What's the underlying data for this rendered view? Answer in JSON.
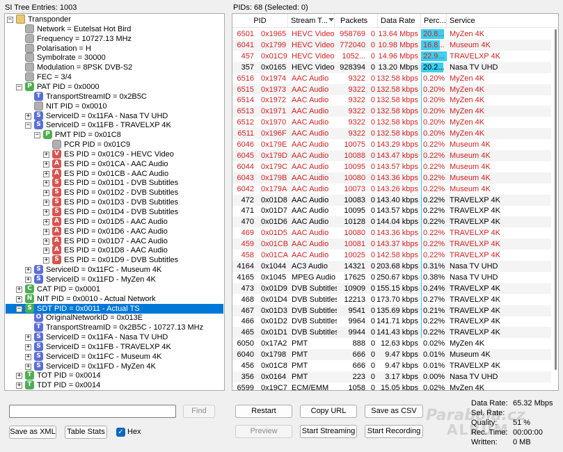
{
  "left_header": "SI Tree Entries: 1003",
  "right_header": "PIDs: 68  (Selected: 0)",
  "tree": [
    {
      "depth": 0,
      "toggle": "-",
      "icon": "folder",
      "letter": "",
      "color": "",
      "text": "Transponder"
    },
    {
      "depth": 1,
      "toggle": "",
      "icon": "grey",
      "letter": "",
      "color": "",
      "text": "Network = Eutelsat Hot Bird"
    },
    {
      "depth": 1,
      "toggle": "",
      "icon": "grey",
      "letter": "",
      "color": "",
      "text": "Frequency = 10727.13 MHz"
    },
    {
      "depth": 1,
      "toggle": "",
      "icon": "grey",
      "letter": "",
      "color": "",
      "text": "Polarisation = H"
    },
    {
      "depth": 1,
      "toggle": "",
      "icon": "grey",
      "letter": "",
      "color": "",
      "text": "Symbolrate = 30000"
    },
    {
      "depth": 1,
      "toggle": "",
      "icon": "grey",
      "letter": "",
      "color": "",
      "text": "Modulation = 8PSK DVB-S2"
    },
    {
      "depth": 1,
      "toggle": "",
      "icon": "grey",
      "letter": "",
      "color": "",
      "text": "FEC = 3/4"
    },
    {
      "depth": 1,
      "toggle": "-",
      "icon": "letter",
      "letter": "P",
      "color": "#4caf50",
      "text": "PAT PID = 0x0000"
    },
    {
      "depth": 2,
      "toggle": "",
      "icon": "letter",
      "letter": "T",
      "color": "#5b6fd6",
      "text": "TransportStreamID = 0x2B5C"
    },
    {
      "depth": 2,
      "toggle": "",
      "icon": "grey",
      "letter": "",
      "color": "",
      "text": "NIT PID = 0x0010"
    },
    {
      "depth": 2,
      "toggle": "+",
      "icon": "letter",
      "letter": "S",
      "color": "#5b6fd6",
      "text": "ServiceID = 0x11FA - Nasa TV UHD"
    },
    {
      "depth": 2,
      "toggle": "-",
      "icon": "letter",
      "letter": "S",
      "color": "#5b6fd6",
      "text": "ServiceID = 0x11FB - TRAVELXP 4K"
    },
    {
      "depth": 3,
      "toggle": "-",
      "icon": "letter",
      "letter": "P",
      "color": "#4caf50",
      "text": "PMT PID = 0x01C8"
    },
    {
      "depth": 4,
      "toggle": "",
      "icon": "grey",
      "letter": "",
      "color": "",
      "text": "PCR PID = 0x01C9"
    },
    {
      "depth": 4,
      "toggle": "+",
      "icon": "letter",
      "letter": "V",
      "color": "#d9534f",
      "text": "ES PID = 0x01C9 - HEVC Video"
    },
    {
      "depth": 4,
      "toggle": "+",
      "icon": "letter",
      "letter": "A",
      "color": "#d9534f",
      "text": "ES PID = 0x01CA - AAC Audio"
    },
    {
      "depth": 4,
      "toggle": "+",
      "icon": "letter",
      "letter": "A",
      "color": "#d9534f",
      "text": "ES PID = 0x01CB - AAC Audio"
    },
    {
      "depth": 4,
      "toggle": "+",
      "icon": "letter",
      "letter": "S",
      "color": "#d9534f",
      "text": "ES PID = 0x01D1 - DVB Subtitles"
    },
    {
      "depth": 4,
      "toggle": "+",
      "icon": "letter",
      "letter": "S",
      "color": "#d9534f",
      "text": "ES PID = 0x01D2 - DVB Subtitles"
    },
    {
      "depth": 4,
      "toggle": "+",
      "icon": "letter",
      "letter": "S",
      "color": "#d9534f",
      "text": "ES PID = 0x01D3 - DVB Subtitles"
    },
    {
      "depth": 4,
      "toggle": "+",
      "icon": "letter",
      "letter": "S",
      "color": "#d9534f",
      "text": "ES PID = 0x01D4 - DVB Subtitles"
    },
    {
      "depth": 4,
      "toggle": "+",
      "icon": "letter",
      "letter": "A",
      "color": "#d9534f",
      "text": "ES PID = 0x01D5 - AAC Audio"
    },
    {
      "depth": 4,
      "toggle": "+",
      "icon": "letter",
      "letter": "A",
      "color": "#d9534f",
      "text": "ES PID = 0x01D6 - AAC Audio"
    },
    {
      "depth": 4,
      "toggle": "+",
      "icon": "letter",
      "letter": "A",
      "color": "#d9534f",
      "text": "ES PID = 0x01D7 - AAC Audio"
    },
    {
      "depth": 4,
      "toggle": "+",
      "icon": "letter",
      "letter": "A",
      "color": "#d9534f",
      "text": "ES PID = 0x01D8 - AAC Audio"
    },
    {
      "depth": 4,
      "toggle": "+",
      "icon": "letter",
      "letter": "S",
      "color": "#d9534f",
      "text": "ES PID = 0x01D9 - DVB Subtitles"
    },
    {
      "depth": 2,
      "toggle": "+",
      "icon": "letter",
      "letter": "S",
      "color": "#5b6fd6",
      "text": "ServiceID = 0x11FC - Museum 4K"
    },
    {
      "depth": 2,
      "toggle": "+",
      "icon": "letter",
      "letter": "S",
      "color": "#5b6fd6",
      "text": "ServiceID = 0x11FD - MyZen 4K"
    },
    {
      "depth": 1,
      "toggle": "+",
      "icon": "letter",
      "letter": "C",
      "color": "#4caf50",
      "text": "CAT PID = 0x0001"
    },
    {
      "depth": 1,
      "toggle": "+",
      "icon": "letter",
      "letter": "N",
      "color": "#4caf50",
      "text": "NIT PID = 0x0010 - Actual Network"
    },
    {
      "depth": 1,
      "toggle": "-",
      "icon": "letter",
      "letter": "S",
      "color": "#4caf50",
      "text": "SDT PID = 0x0011 - Actual TS",
      "selected": true
    },
    {
      "depth": 2,
      "toggle": "",
      "icon": "letter",
      "letter": "O",
      "color": "#5b6fd6",
      "text": "OriginalNetworkID = 0x013E"
    },
    {
      "depth": 2,
      "toggle": "",
      "icon": "letter",
      "letter": "T",
      "color": "#5b6fd6",
      "text": "TransportStreamID = 0x2B5C - 10727.13 MHz"
    },
    {
      "depth": 2,
      "toggle": "+",
      "icon": "letter",
      "letter": "S",
      "color": "#5b6fd6",
      "text": "ServiceID = 0x11FA - Nasa TV UHD"
    },
    {
      "depth": 2,
      "toggle": "+",
      "icon": "letter",
      "letter": "S",
      "color": "#5b6fd6",
      "text": "ServiceID = 0x11FB - TRAVELXP 4K"
    },
    {
      "depth": 2,
      "toggle": "+",
      "icon": "letter",
      "letter": "S",
      "color": "#5b6fd6",
      "text": "ServiceID = 0x11FC - Museum 4K"
    },
    {
      "depth": 2,
      "toggle": "+",
      "icon": "letter",
      "letter": "S",
      "color": "#5b6fd6",
      "text": "ServiceID = 0x11FD - MyZen 4K"
    },
    {
      "depth": 1,
      "toggle": "+",
      "icon": "letter",
      "letter": "T",
      "color": "#4caf50",
      "text": "TOT PID = 0x0014"
    },
    {
      "depth": 1,
      "toggle": "+",
      "icon": "letter",
      "letter": "T",
      "color": "#4caf50",
      "text": "TDT PID = 0x0014"
    }
  ],
  "columns": [
    "PID",
    "Stream T...",
    "Packets",
    "Data Rate",
    "Perc...",
    "Service"
  ],
  "rows": [
    {
      "pid_dec": "6501",
      "pid_hex": "0x1965",
      "type": "HEVC Video",
      "packets": "958769",
      "cc": "0",
      "rate": "13.64 Mbps",
      "perc": "20.8...",
      "pct": 20.8,
      "service": "MyZen 4K",
      "red": true
    },
    {
      "pid_dec": "6041",
      "pid_hex": "0x1799",
      "type": "HEVC Video",
      "packets": "772040",
      "cc": "0",
      "rate": "10.98 Mbps",
      "perc": "16.8...",
      "pct": 16.8,
      "service": "Museum 4K",
      "red": true
    },
    {
      "pid_dec": "457",
      "pid_hex": "0x01C9",
      "type": "HEVC Video",
      "packets": "1052...",
      "cc": "0",
      "rate": "14.96 Mbps",
      "perc": "22.9...",
      "pct": 22.9,
      "service": "TRAVELXP 4K",
      "red": true
    },
    {
      "pid_dec": "357",
      "pid_hex": "0x0165",
      "type": "HEVC Video",
      "packets": "928394",
      "cc": "0",
      "rate": "13.20 Mbps",
      "perc": "20.2...",
      "pct": 20.2,
      "service": "Nasa TV UHD",
      "red": false
    },
    {
      "pid_dec": "6516",
      "pid_hex": "0x1974",
      "type": "AAC Audio",
      "packets": "9322",
      "cc": "0",
      "rate": "132.58 kbps",
      "perc": "0.20%",
      "pct": 0.2,
      "service": "MyZen 4K",
      "red": true
    },
    {
      "pid_dec": "6515",
      "pid_hex": "0x1973",
      "type": "AAC Audio",
      "packets": "9322",
      "cc": "0",
      "rate": "132.58 kbps",
      "perc": "0.20%",
      "pct": 0.2,
      "service": "MyZen 4K",
      "red": true
    },
    {
      "pid_dec": "6514",
      "pid_hex": "0x1972",
      "type": "AAC Audio",
      "packets": "9322",
      "cc": "0",
      "rate": "132.58 kbps",
      "perc": "0.20%",
      "pct": 0.2,
      "service": "MyZen 4K",
      "red": true
    },
    {
      "pid_dec": "6513",
      "pid_hex": "0x1971",
      "type": "AAC Audio",
      "packets": "9322",
      "cc": "0",
      "rate": "132.58 kbps",
      "perc": "0.20%",
      "pct": 0.2,
      "service": "MyZen 4K",
      "red": true
    },
    {
      "pid_dec": "6512",
      "pid_hex": "0x1970",
      "type": "AAC Audio",
      "packets": "9322",
      "cc": "0",
      "rate": "132.58 kbps",
      "perc": "0.20%",
      "pct": 0.2,
      "service": "MyZen 4K",
      "red": true
    },
    {
      "pid_dec": "6511",
      "pid_hex": "0x196F",
      "type": "AAC Audio",
      "packets": "9322",
      "cc": "0",
      "rate": "132.58 kbps",
      "perc": "0.20%",
      "pct": 0.2,
      "service": "MyZen 4K",
      "red": true
    },
    {
      "pid_dec": "6046",
      "pid_hex": "0x179E",
      "type": "AAC Audio",
      "packets": "10075",
      "cc": "0",
      "rate": "143.29 kbps",
      "perc": "0.22%",
      "pct": 0.22,
      "service": "Museum 4K",
      "red": true
    },
    {
      "pid_dec": "6045",
      "pid_hex": "0x179D",
      "type": "AAC Audio",
      "packets": "10088",
      "cc": "0",
      "rate": "143.47 kbps",
      "perc": "0.22%",
      "pct": 0.22,
      "service": "Museum 4K",
      "red": true
    },
    {
      "pid_dec": "6044",
      "pid_hex": "0x179C",
      "type": "AAC Audio",
      "packets": "10095",
      "cc": "0",
      "rate": "143.57 kbps",
      "perc": "0.22%",
      "pct": 0.22,
      "service": "Museum 4K",
      "red": true
    },
    {
      "pid_dec": "6043",
      "pid_hex": "0x179B",
      "type": "AAC Audio",
      "packets": "10080",
      "cc": "0",
      "rate": "143.36 kbps",
      "perc": "0.22%",
      "pct": 0.22,
      "service": "Museum 4K",
      "red": true
    },
    {
      "pid_dec": "6042",
      "pid_hex": "0x179A",
      "type": "AAC Audio",
      "packets": "10073",
      "cc": "0",
      "rate": "143.26 kbps",
      "perc": "0.22%",
      "pct": 0.22,
      "service": "Museum 4K",
      "red": true
    },
    {
      "pid_dec": "472",
      "pid_hex": "0x01D8",
      "type": "AAC Audio",
      "packets": "10083",
      "cc": "0",
      "rate": "143.40 kbps",
      "perc": "0.22%",
      "pct": 0.22,
      "service": "TRAVELXP 4K",
      "red": false
    },
    {
      "pid_dec": "471",
      "pid_hex": "0x01D7",
      "type": "AAC Audio",
      "packets": "10095",
      "cc": "0",
      "rate": "143.57 kbps",
      "perc": "0.22%",
      "pct": 0.22,
      "service": "TRAVELXP 4K",
      "red": false
    },
    {
      "pid_dec": "470",
      "pid_hex": "0x01D6",
      "type": "AAC Audio",
      "packets": "10128",
      "cc": "0",
      "rate": "144.04 kbps",
      "perc": "0.22%",
      "pct": 0.22,
      "service": "TRAVELXP 4K",
      "red": false
    },
    {
      "pid_dec": "469",
      "pid_hex": "0x01D5",
      "type": "AAC Audio",
      "packets": "10080",
      "cc": "0",
      "rate": "143.36 kbps",
      "perc": "0.22%",
      "pct": 0.22,
      "service": "TRAVELXP 4K",
      "red": true
    },
    {
      "pid_dec": "459",
      "pid_hex": "0x01CB",
      "type": "AAC Audio",
      "packets": "10081",
      "cc": "0",
      "rate": "143.37 kbps",
      "perc": "0.22%",
      "pct": 0.22,
      "service": "TRAVELXP 4K",
      "red": true
    },
    {
      "pid_dec": "458",
      "pid_hex": "0x01CA",
      "type": "AAC Audio",
      "packets": "10025",
      "cc": "0",
      "rate": "142.58 kbps",
      "perc": "0.22%",
      "pct": 0.22,
      "service": "TRAVELXP 4K",
      "red": true
    },
    {
      "pid_dec": "4164",
      "pid_hex": "0x1044",
      "type": "AC3 Audio",
      "packets": "14321",
      "cc": "0",
      "rate": "203.68 kbps",
      "perc": "0.31%",
      "pct": 0.31,
      "service": "Nasa TV UHD",
      "red": false
    },
    {
      "pid_dec": "4165",
      "pid_hex": "0x1045",
      "type": "MPEG Audio",
      "packets": "17625",
      "cc": "0",
      "rate": "250.67 kbps",
      "perc": "0.38%",
      "pct": 0.38,
      "service": "Nasa TV UHD",
      "red": false
    },
    {
      "pid_dec": "473",
      "pid_hex": "0x01D9",
      "type": "DVB Subtitles",
      "packets": "10909",
      "cc": "0",
      "rate": "155.15 kbps",
      "perc": "0.24%",
      "pct": 0.24,
      "service": "TRAVELXP 4K",
      "red": false
    },
    {
      "pid_dec": "468",
      "pid_hex": "0x01D4",
      "type": "DVB Subtitles",
      "packets": "12213",
      "cc": "0",
      "rate": "173.70 kbps",
      "perc": "0.27%",
      "pct": 0.27,
      "service": "TRAVELXP 4K",
      "red": false
    },
    {
      "pid_dec": "467",
      "pid_hex": "0x01D3",
      "type": "DVB Subtitles",
      "packets": "9541",
      "cc": "0",
      "rate": "135.69 kbps",
      "perc": "0.21%",
      "pct": 0.21,
      "service": "TRAVELXP 4K",
      "red": false
    },
    {
      "pid_dec": "466",
      "pid_hex": "0x01D2",
      "type": "DVB Subtitles",
      "packets": "9964",
      "cc": "0",
      "rate": "141.71 kbps",
      "perc": "0.22%",
      "pct": 0.22,
      "service": "TRAVELXP 4K",
      "red": false
    },
    {
      "pid_dec": "465",
      "pid_hex": "0x01D1",
      "type": "DVB Subtitles",
      "packets": "9944",
      "cc": "0",
      "rate": "141.43 kbps",
      "perc": "0.22%",
      "pct": 0.22,
      "service": "TRAVELXP 4K",
      "red": false
    },
    {
      "pid_dec": "6050",
      "pid_hex": "0x17A2",
      "type": "PMT",
      "packets": "888",
      "cc": "0",
      "rate": "12.63 kbps",
      "perc": "0.02%",
      "pct": 0.02,
      "service": "MyZen 4K",
      "red": false
    },
    {
      "pid_dec": "6040",
      "pid_hex": "0x1798",
      "type": "PMT",
      "packets": "666",
      "cc": "0",
      "rate": "9.47 kbps",
      "perc": "0.01%",
      "pct": 0.01,
      "service": "Museum 4K",
      "red": false
    },
    {
      "pid_dec": "456",
      "pid_hex": "0x01C8",
      "type": "PMT",
      "packets": "666",
      "cc": "0",
      "rate": "9.47 kbps",
      "perc": "0.01%",
      "pct": 0.01,
      "service": "TRAVELXP 4K",
      "red": false
    },
    {
      "pid_dec": "356",
      "pid_hex": "0x0164",
      "type": "PMT",
      "packets": "223",
      "cc": "0",
      "rate": "3.17 kbps",
      "perc": "0.00%",
      "pct": 0.0,
      "service": "Nasa TV UHD",
      "red": false
    },
    {
      "pid_dec": "6599",
      "pid_hex": "0x19C7",
      "type": "ECM/EMM",
      "packets": "1058",
      "cc": "0",
      "rate": "15.05 kbps",
      "perc": "0.02%",
      "pct": 0.02,
      "service": "MyZen 4K",
      "red": false
    }
  ],
  "find_placeholder": "",
  "buttons": {
    "find": "Find",
    "save_xml": "Save as XML",
    "table_stats": "Table Stats",
    "hex": "Hex",
    "restart": "Restart",
    "copy_url": "Copy URL",
    "save_csv": "Save as CSV",
    "preview": "Preview",
    "start_streaming": "Start Streaming",
    "start_recording": "Start Recording"
  },
  "hex_checked": true,
  "stats": {
    "data_rate_label": "Data Rate:",
    "data_rate_value": "65.32 Mbps",
    "sel_rate_label": "Sel. Rate:",
    "sel_rate_value": "",
    "quality_label": "Quality:",
    "quality_value": "51 %",
    "rec_time_label": "Rec. Time:",
    "rec_time_value": "00:00:00",
    "written_label": "Written:",
    "written_value": "0 MB"
  },
  "watermark_line1": "Parabola.cz",
  "watermark_line2": "ALBUM",
  "colors": {
    "accent": "#0078d7",
    "error_text": "#d42020",
    "perc_bar": "#39cff0"
  }
}
